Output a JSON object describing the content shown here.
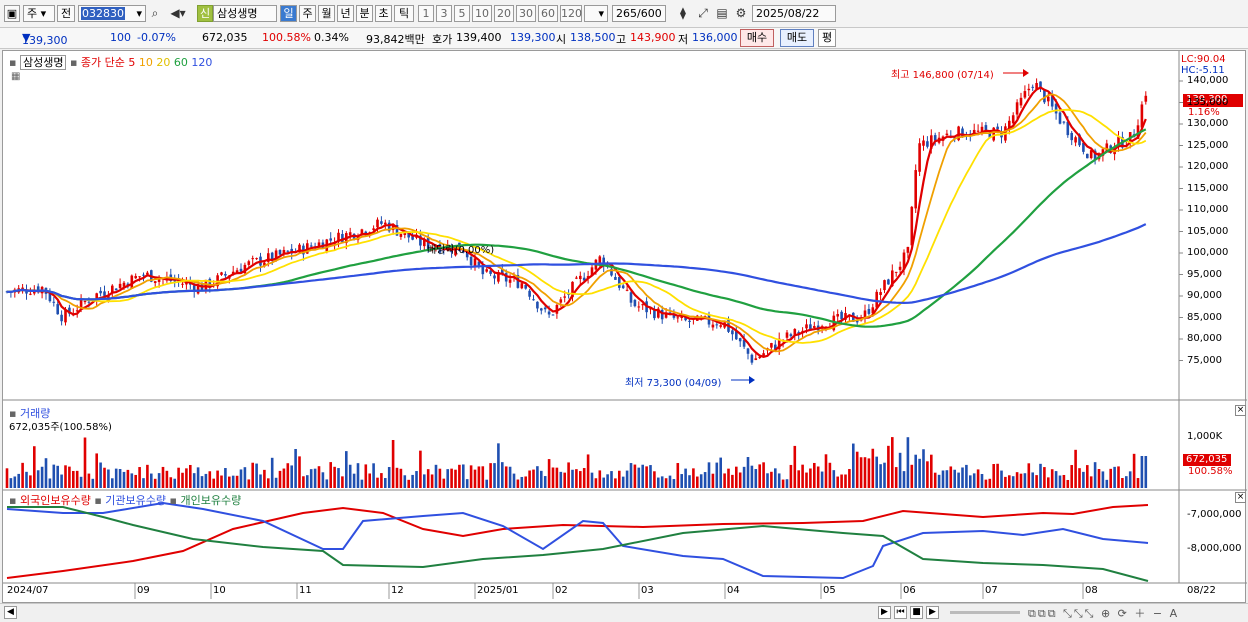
{
  "toolbar": {
    "period": "주",
    "prev": "전",
    "code": "032830",
    "credit": "신",
    "name": "삼성생명",
    "periods": [
      "일",
      "주",
      "월",
      "년",
      "분",
      "초",
      "틱"
    ],
    "nums": [
      "1",
      "3",
      "5",
      "10",
      "20",
      "30",
      "60",
      "120"
    ],
    "count": "265",
    "count_max": "/600",
    "date": "2025/08/22"
  },
  "info": {
    "price": "139,300",
    "change": "100",
    "change_pct": "-0.07%",
    "volume": "672,035",
    "vol_ratio": "100.58%",
    "turnover": "0.34%",
    "amount": "93,842백만",
    "quote_label": "호가",
    "quote": "139,400",
    "quote2": "139,300",
    "open_label": "시",
    "open": "138,500",
    "high_label": "고",
    "high": "143,900",
    "low_label": "저",
    "low": "136,000",
    "buy": "매수",
    "sell": "매도",
    "eval": "평"
  },
  "price_panel": {
    "name": "삼성생명",
    "ma_label": "종가 단순",
    "ma_periods": [
      "5",
      "10",
      "20",
      "60",
      "120"
    ],
    "ma_colors": [
      "#e00000",
      "#f0a000",
      "#ffe000",
      "#20a040",
      "#3050e0"
    ],
    "lc": "LC:90.04",
    "hc": "HC:-5.11",
    "current": "139,300",
    "current_pct": "1.16%",
    "high_note": "최고 146,800 (07/14)",
    "low_note": "최저 73,300 (04/09)",
    "dividend_note": "배당락(0.00%)",
    "y_ticks": [
      "140,000",
      "135,000",
      "130,000",
      "125,000",
      "120,000",
      "115,000",
      "110,000",
      "105,000",
      "100,000",
      "95,000",
      "90,000",
      "85,000",
      "80,000",
      "75,000"
    ]
  },
  "volume_panel": {
    "title": "거래량",
    "value": "672,035주(100.58%)",
    "tick": "1,000K",
    "current": "672,035",
    "current_pct": "100.58%"
  },
  "holdings_panel": {
    "series": [
      "외국인보유수량",
      "기관보유수량",
      "개인보유수량"
    ],
    "colors": [
      "#e00000",
      "#3050e0",
      "#208040"
    ],
    "ticks": [
      "-7,000,000",
      "-8,000,000"
    ]
  },
  "x_axis": [
    "2024/07",
    "09",
    "10",
    "11",
    "12",
    "2025/01",
    "02",
    "03",
    "04",
    "05",
    "06",
    "07",
    "08",
    "08/22"
  ]
}
